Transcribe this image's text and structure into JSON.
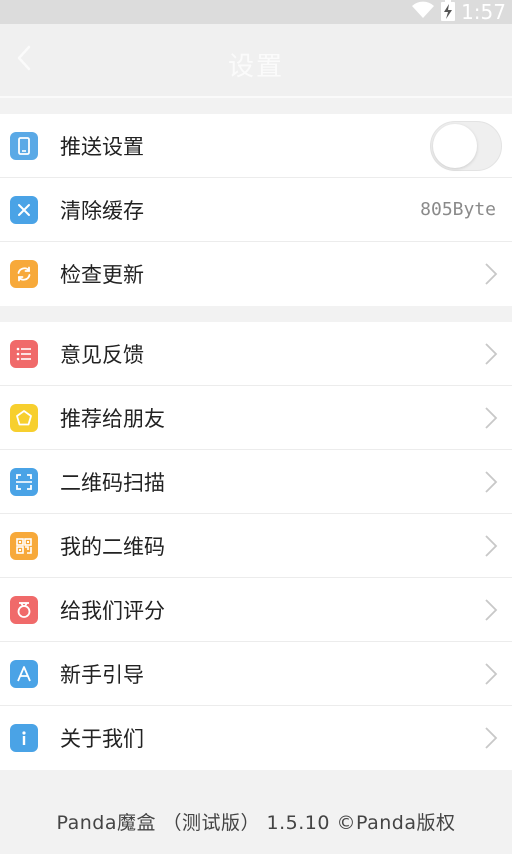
{
  "status": {
    "time": "1:57",
    "icons": [
      "wifi-icon",
      "battery-charging-icon"
    ]
  },
  "header": {
    "title": "设置",
    "back_icon": "chevron-left-icon"
  },
  "groups": [
    {
      "items": [
        {
          "label": "推送设置",
          "icon": "phone-icon",
          "color": "#5aa9e6",
          "control": "toggle",
          "toggle_on": false
        },
        {
          "label": "清除缓存",
          "icon": "close-x-icon",
          "color": "#4aa3e6",
          "value": "805Byte"
        },
        {
          "label": "检查更新",
          "icon": "refresh-icon",
          "color": "#f7a93a",
          "chevron": true
        }
      ]
    },
    {
      "items": [
        {
          "label": "意见反馈",
          "icon": "list-icon",
          "color": "#f06a6a",
          "chevron": true
        },
        {
          "label": "推荐给朋友",
          "icon": "pentagon-icon",
          "color": "#f7cf2e",
          "chevron": true
        },
        {
          "label": "二维码扫描",
          "icon": "scan-icon",
          "color": "#4aa3e6",
          "chevron": true
        },
        {
          "label": "我的二维码",
          "icon": "qr-code-icon",
          "color": "#f7a93a",
          "chevron": true
        },
        {
          "label": "给我们评分",
          "icon": "medal-icon",
          "color": "#f06a6a",
          "chevron": true
        },
        {
          "label": "新手引导",
          "icon": "letter-a-icon",
          "color": "#4aa3e6",
          "chevron": true
        },
        {
          "label": "关于我们",
          "icon": "info-icon",
          "color": "#4aa3e6",
          "chevron": true
        }
      ]
    }
  ],
  "footer": {
    "text": "Panda魔盒 （测试版） 1.5.10 ©Panda版权"
  }
}
